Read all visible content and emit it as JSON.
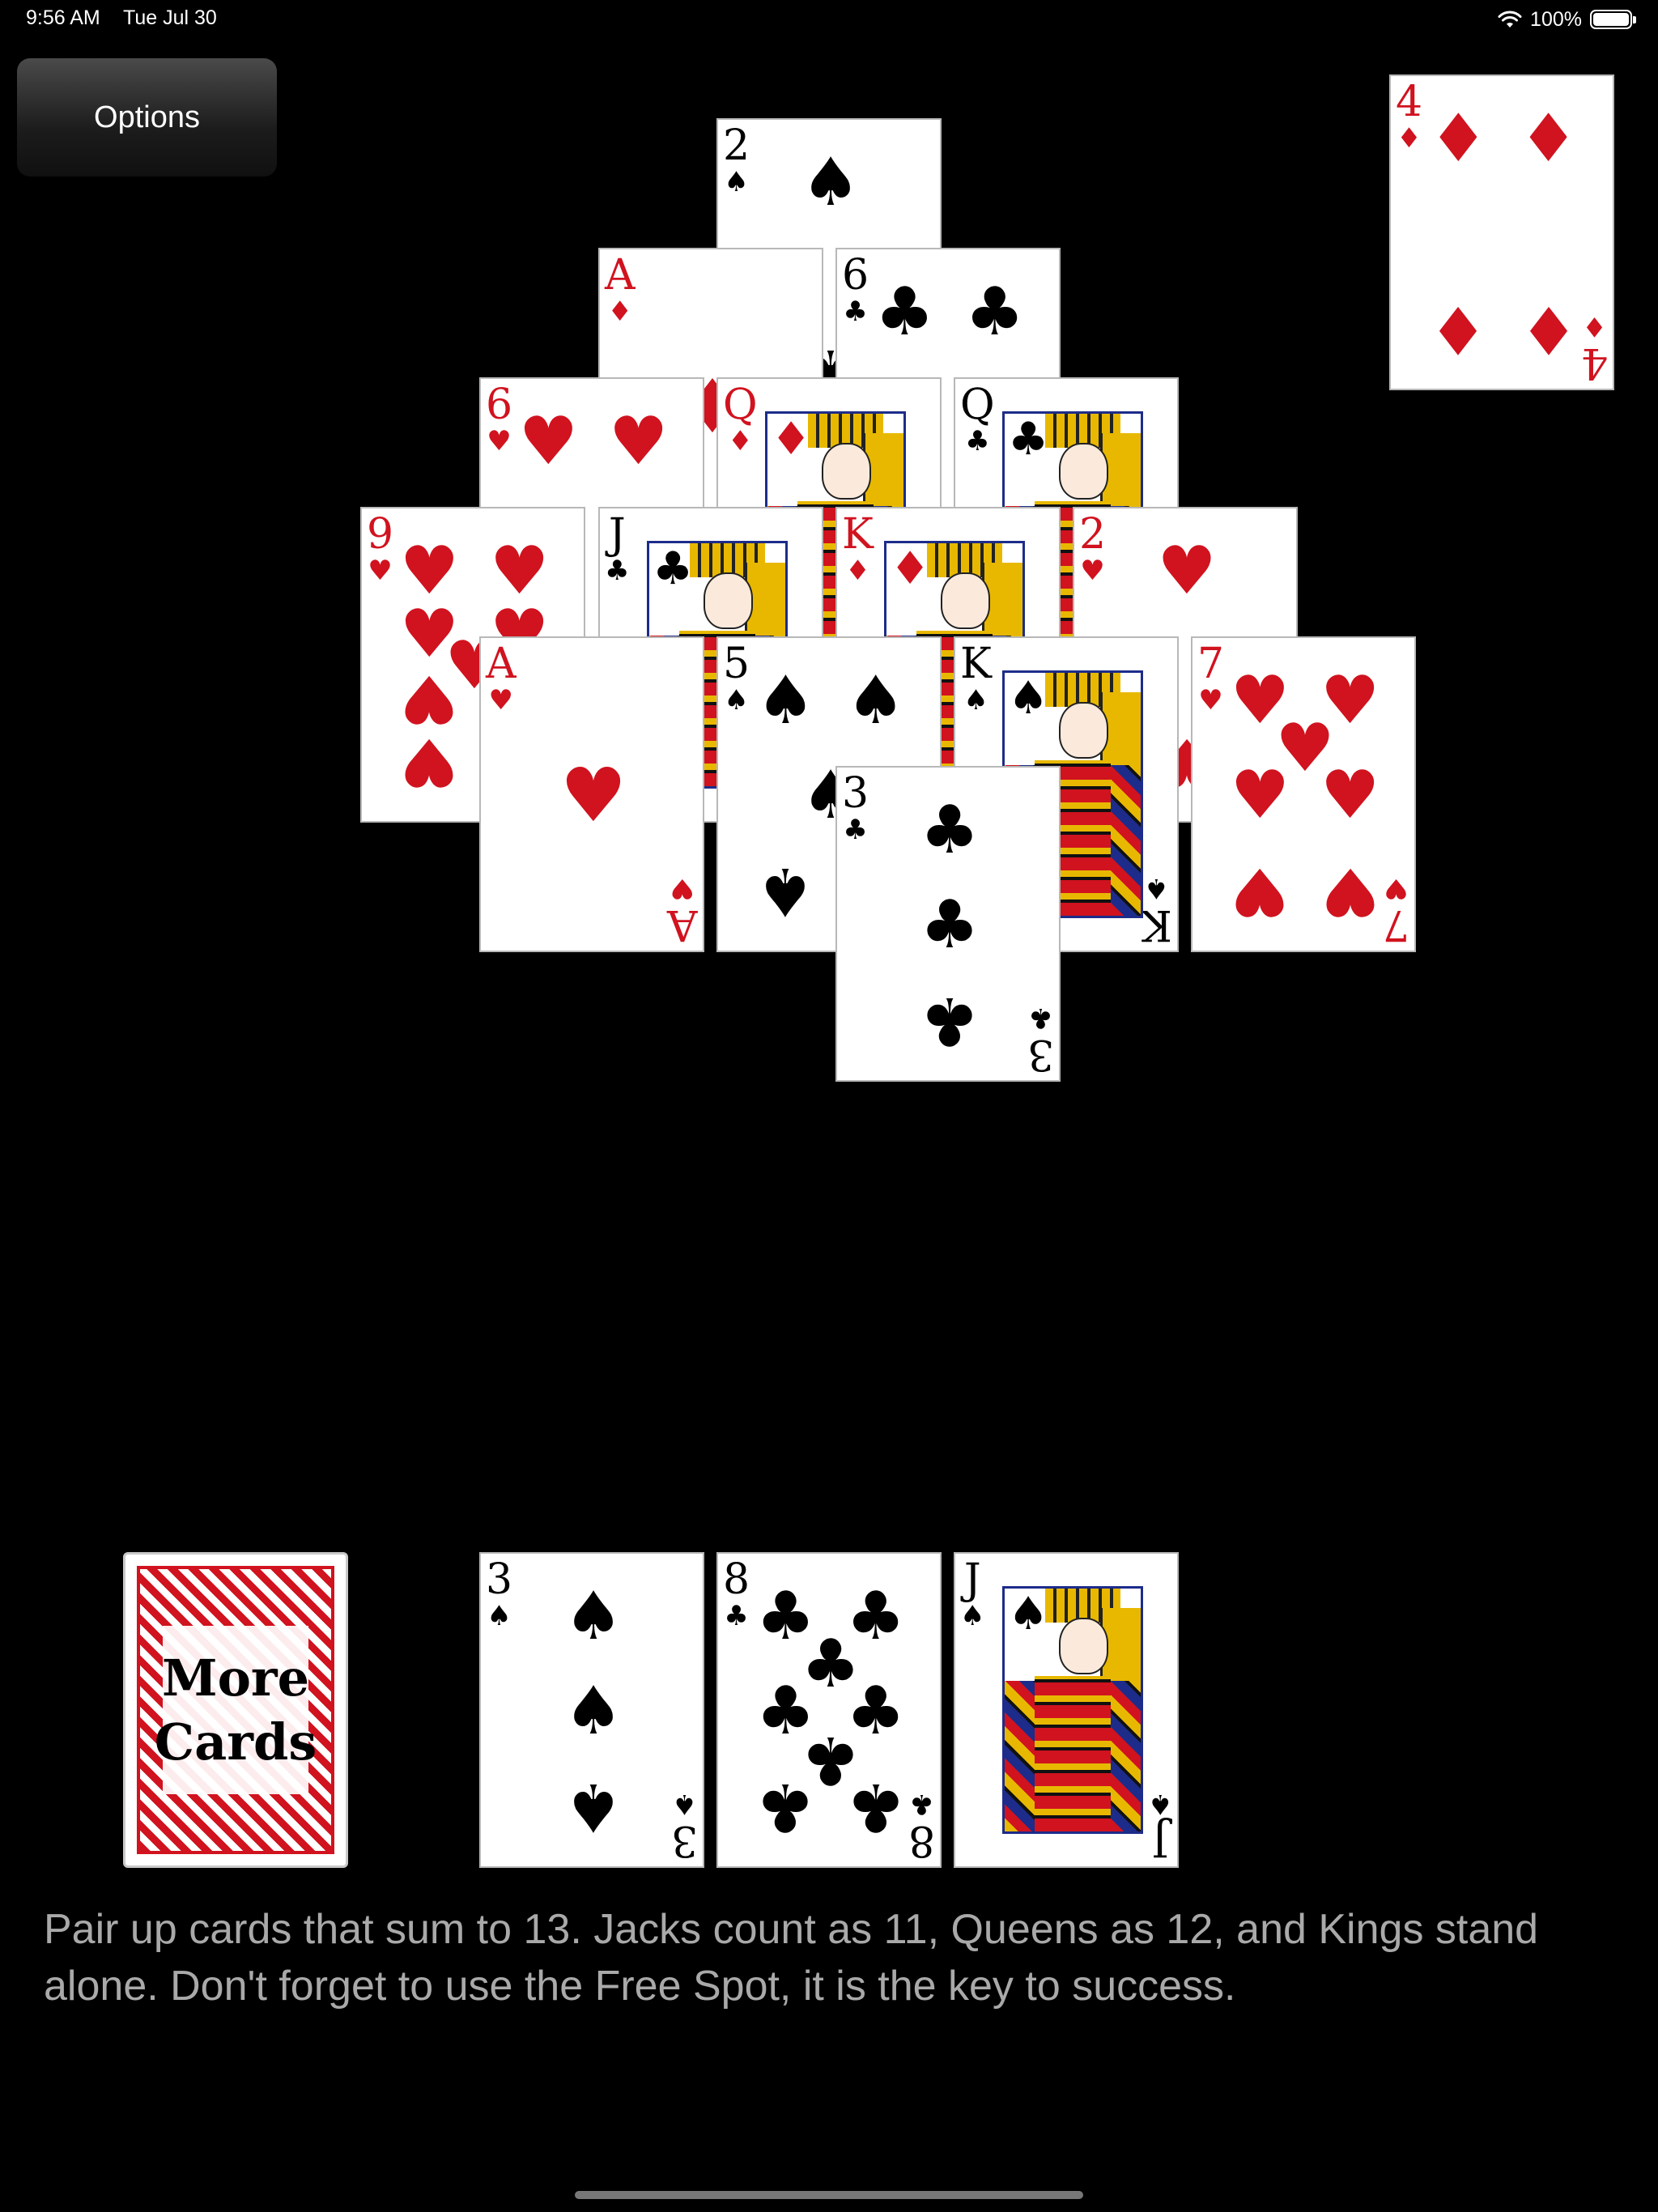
{
  "status_bar": {
    "time": "9:56 AM",
    "date": "Tue Jul 30",
    "battery": "100%"
  },
  "options": {
    "label": "Options"
  },
  "free_spot": {
    "rank": "4",
    "suit": "♦",
    "color": "red",
    "pips": 4
  },
  "pyramid": [
    {
      "rank": "2",
      "suit": "♠",
      "color": "black",
      "pips": 2
    },
    {
      "rank": "A",
      "suit": "♦",
      "color": "red",
      "pips": 1
    },
    {
      "rank": "6",
      "suit": "♣",
      "color": "black",
      "pips": 6
    },
    {
      "rank": "6",
      "suit": "♥",
      "color": "red",
      "pips": 6
    },
    {
      "rank": "Q",
      "suit": "♦",
      "color": "red",
      "face": true
    },
    {
      "rank": "Q",
      "suit": "♣",
      "color": "black",
      "face": true
    },
    {
      "rank": "9",
      "suit": "♥",
      "color": "red",
      "pips": 9
    },
    {
      "rank": "J",
      "suit": "♣",
      "color": "black",
      "face": true
    },
    {
      "rank": "K",
      "suit": "♦",
      "color": "red",
      "face": true
    },
    {
      "rank": "2",
      "suit": "♥",
      "color": "red",
      "pips": 2
    },
    {
      "rank": "A",
      "suit": "♥",
      "color": "red",
      "pips": 1
    },
    {
      "rank": "5",
      "suit": "♠",
      "color": "black",
      "pips": 5
    },
    {
      "rank": "K",
      "suit": "♠",
      "color": "black",
      "face": true
    },
    {
      "rank": "7",
      "suit": "♥",
      "color": "red",
      "pips": 7
    },
    {
      "rank": "3",
      "suit": "♣",
      "color": "black",
      "pips": 3
    }
  ],
  "waste": [
    {
      "rank": "3",
      "suit": "♠",
      "color": "black",
      "pips": 3
    },
    {
      "rank": "8",
      "suit": "♣",
      "color": "black",
      "pips": 8
    },
    {
      "rank": "J",
      "suit": "♠",
      "color": "black",
      "face": true
    }
  ],
  "more_cards": {
    "line1": "More",
    "line2": "Cards"
  },
  "help_text": "Pair up cards that sum to 13. Jacks count as 11, Queens as 12, and Kings stand alone. Don't forget to use the Free Spot, it is the key to success."
}
